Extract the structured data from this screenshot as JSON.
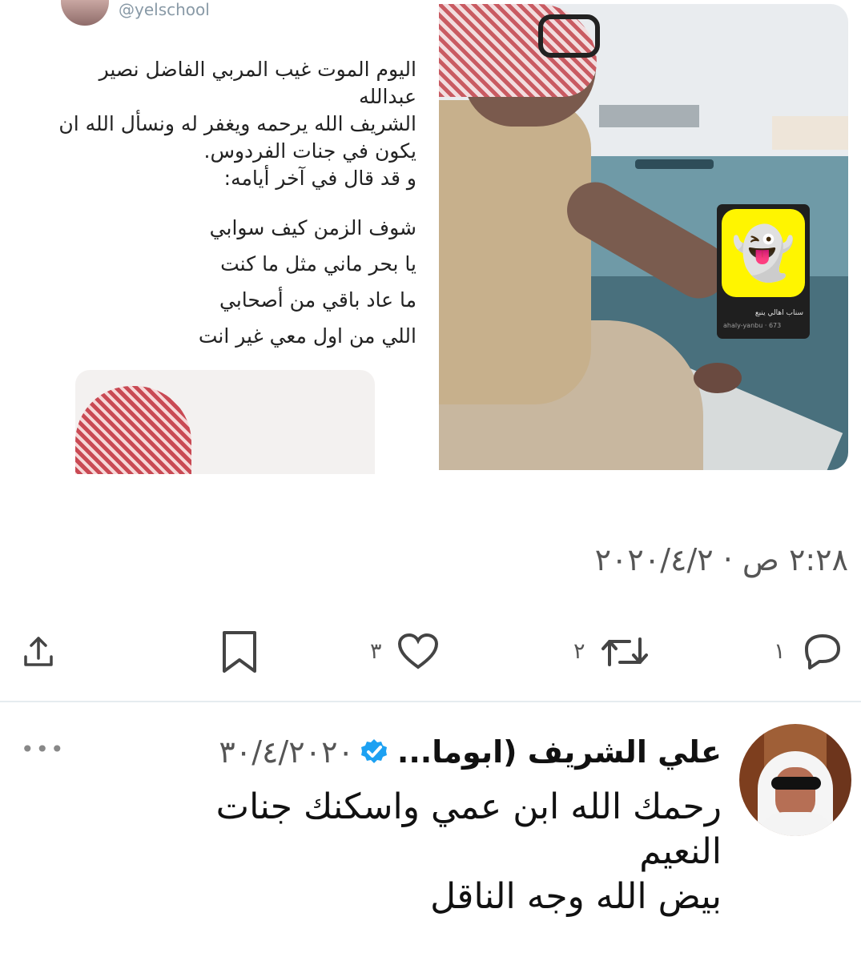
{
  "quoted_tweet": {
    "handle": "@yelschool",
    "text_lines": [
      "اليوم الموت غيب المربي الفاضل نصير عبدالله",
      "الشريف الله يرحمه ويغفر له ونسأل الله ان",
      "يكون في جنات الفردوس.",
      "و قد قال في آخر أيامه:"
    ],
    "poem_lines": [
      "شوف الزمن كيف سوابي",
      "يا بحر ماني مثل ما كنت",
      "ما عاد باقي من أصحابي",
      "اللي من اول معي غير انت"
    ]
  },
  "snapcode": {
    "label": "سناب اهالي ينبع",
    "handle": "ahaly-yanbu",
    "count": "673"
  },
  "tweet": {
    "timestamp": "٢:٢٨ ص · ٢٠٢٠/٤/٢"
  },
  "actions": {
    "reply_count": "١",
    "retweet_count": "٢",
    "like_count": "٣"
  },
  "reply": {
    "author": "علي الشريف (ابوما...",
    "date": "٣٠/٤/٢٠٢٠",
    "more": "•••",
    "lines": [
      "رحمك الله ابن عمي واسكنك جنات",
      "النعيم",
      "بيض الله وجه الناقل"
    ]
  },
  "icons": {
    "share": "share-icon",
    "bookmark": "bookmark-icon",
    "like": "heart-icon",
    "retweet": "retweet-icon",
    "reply": "reply-icon",
    "verified": "verified-badge-icon"
  },
  "colors": {
    "verified": "#1da1f2",
    "snap_yellow": "#fff500"
  }
}
